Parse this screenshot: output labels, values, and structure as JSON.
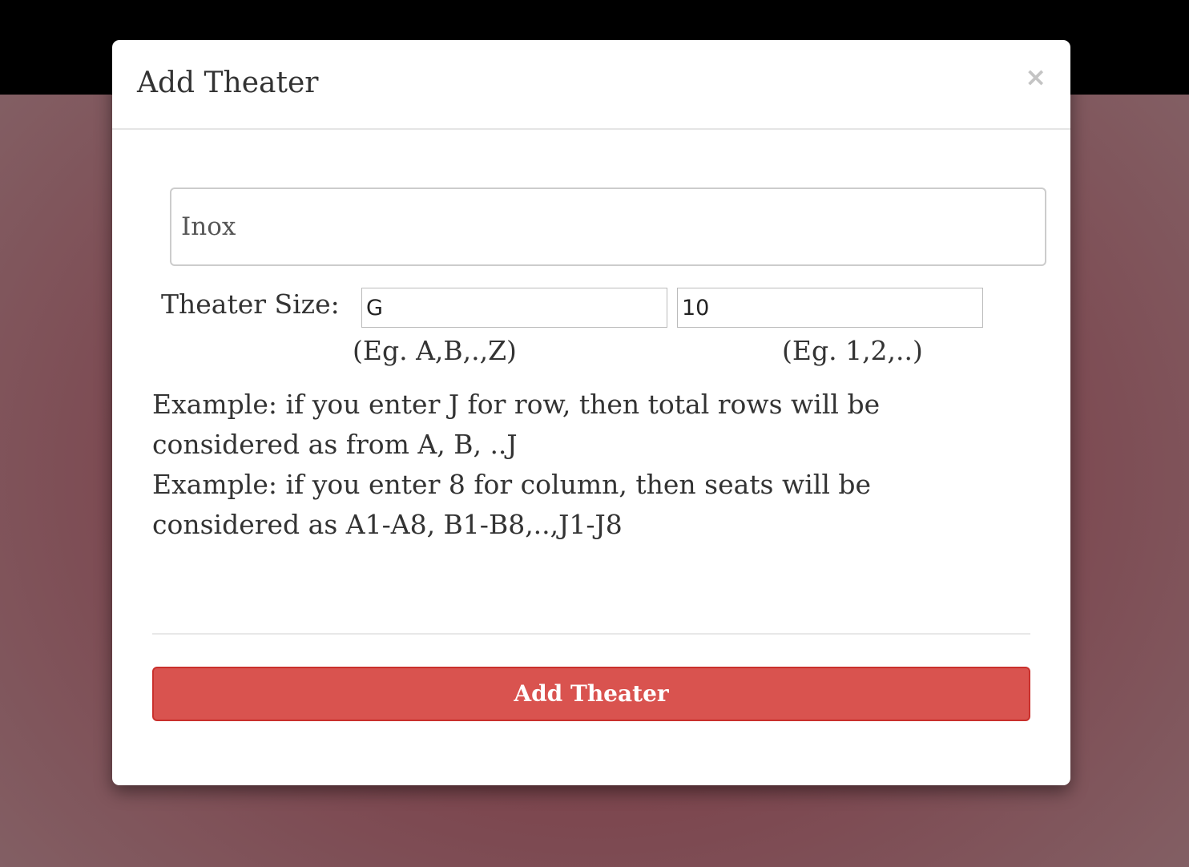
{
  "modal": {
    "title": "Add Theater",
    "close_symbol": "×"
  },
  "form": {
    "theater_name_value": "Inox",
    "size_label": "Theater Size:",
    "row_value": "G",
    "col_value": "10",
    "row_hint": "(Eg. A,B,.,Z)",
    "col_hint": "(Eg. 1,2,..)",
    "example_rows": "Example: if you enter J for row, then total rows will be considered as from A, B, ..J",
    "example_cols": "Example: if you enter 8 for column, then seats will be considered as A1-A8, B1-B8,..,J1-J8",
    "submit_label": "Add Theater"
  },
  "colors": {
    "submit_bg": "#d9534f",
    "overlay": "#7d4a52",
    "top_bar": "#000000"
  },
  "icons": {
    "close": "close-icon"
  }
}
